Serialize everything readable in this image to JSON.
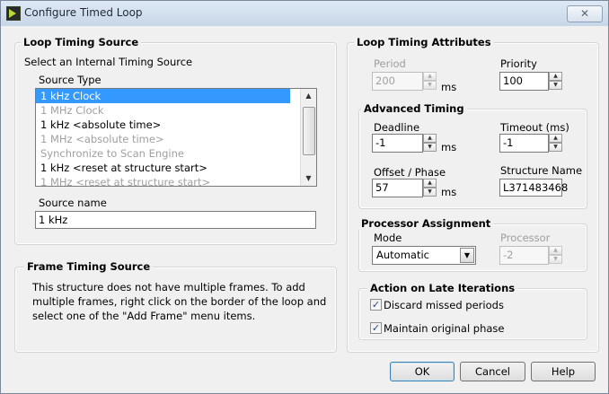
{
  "window": {
    "title": "Configure Timed Loop",
    "close_glyph": "✕"
  },
  "loop_timing_source": {
    "group_title": "Loop Timing Source",
    "instruction": "Select an Internal Timing Source",
    "source_type_label": "Source Type",
    "items": [
      {
        "label": "1 kHz Clock",
        "state": "selected"
      },
      {
        "label": "1 MHz Clock",
        "state": "disabled"
      },
      {
        "label": "1 kHz <absolute time>",
        "state": "normal"
      },
      {
        "label": "1 MHz <absolute time>",
        "state": "disabled"
      },
      {
        "label": "Synchronize to Scan Engine",
        "state": "disabled"
      },
      {
        "label": "1 kHz <reset at structure start>",
        "state": "normal"
      },
      {
        "label": "1 MHz <reset at structure start>",
        "state": "disabled"
      }
    ],
    "source_name_label": "Source name",
    "source_name_value": "1 kHz"
  },
  "frame_timing_source": {
    "group_title": "Frame Timing Source",
    "lines": [
      "This structure does not have multiple frames. To add",
      "multiple frames, right click on the border of the loop and",
      "select one of the \"Add Frame\" menu items."
    ]
  },
  "loop_timing_attributes": {
    "group_title": "Loop Timing Attributes",
    "period_label": "Period",
    "period_value": "200",
    "period_unit": "ms",
    "priority_label": "Priority",
    "priority_value": "100"
  },
  "advanced_timing": {
    "group_title": "Advanced Timing",
    "deadline_label": "Deadline",
    "deadline_value": "-1",
    "deadline_unit": "ms",
    "timeout_label": "Timeout (ms)",
    "timeout_value": "-1",
    "offset_label": "Offset / Phase",
    "offset_value": "57",
    "offset_unit": "ms",
    "structure_name_label": "Structure Name",
    "structure_name_value": "L371483468"
  },
  "processor_assignment": {
    "group_title": "Processor Assignment",
    "mode_label": "Mode",
    "mode_value": "Automatic",
    "processor_label": "Processor",
    "processor_value": "-2"
  },
  "late_iterations": {
    "group_title": "Action on Late Iterations",
    "discard_label": "Discard missed periods",
    "discard_checked": true,
    "maintain_label": "Maintain original phase",
    "maintain_checked": true
  },
  "buttons": {
    "ok": "OK",
    "cancel": "Cancel",
    "help": "Help"
  },
  "glyphs": {
    "check": "✓",
    "up": "▲",
    "down": "▼"
  }
}
